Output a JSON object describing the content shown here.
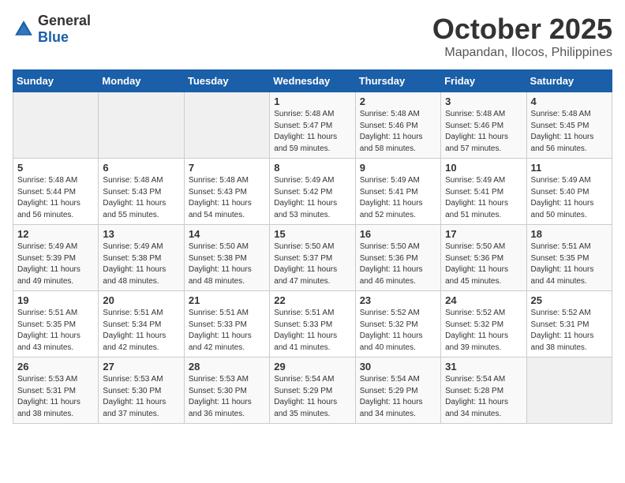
{
  "header": {
    "logo": {
      "general": "General",
      "blue": "Blue"
    },
    "title": "October 2025",
    "location": "Mapandan, Ilocos, Philippines"
  },
  "weekdays": [
    "Sunday",
    "Monday",
    "Tuesday",
    "Wednesday",
    "Thursday",
    "Friday",
    "Saturday"
  ],
  "weeks": [
    [
      {
        "day": "",
        "sunrise": "",
        "sunset": "",
        "daylight": ""
      },
      {
        "day": "",
        "sunrise": "",
        "sunset": "",
        "daylight": ""
      },
      {
        "day": "",
        "sunrise": "",
        "sunset": "",
        "daylight": ""
      },
      {
        "day": "1",
        "sunrise": "Sunrise: 5:48 AM",
        "sunset": "Sunset: 5:47 PM",
        "daylight": "Daylight: 11 hours and 59 minutes."
      },
      {
        "day": "2",
        "sunrise": "Sunrise: 5:48 AM",
        "sunset": "Sunset: 5:46 PM",
        "daylight": "Daylight: 11 hours and 58 minutes."
      },
      {
        "day": "3",
        "sunrise": "Sunrise: 5:48 AM",
        "sunset": "Sunset: 5:46 PM",
        "daylight": "Daylight: 11 hours and 57 minutes."
      },
      {
        "day": "4",
        "sunrise": "Sunrise: 5:48 AM",
        "sunset": "Sunset: 5:45 PM",
        "daylight": "Daylight: 11 hours and 56 minutes."
      }
    ],
    [
      {
        "day": "5",
        "sunrise": "Sunrise: 5:48 AM",
        "sunset": "Sunset: 5:44 PM",
        "daylight": "Daylight: 11 hours and 56 minutes."
      },
      {
        "day": "6",
        "sunrise": "Sunrise: 5:48 AM",
        "sunset": "Sunset: 5:43 PM",
        "daylight": "Daylight: 11 hours and 55 minutes."
      },
      {
        "day": "7",
        "sunrise": "Sunrise: 5:48 AM",
        "sunset": "Sunset: 5:43 PM",
        "daylight": "Daylight: 11 hours and 54 minutes."
      },
      {
        "day": "8",
        "sunrise": "Sunrise: 5:49 AM",
        "sunset": "Sunset: 5:42 PM",
        "daylight": "Daylight: 11 hours and 53 minutes."
      },
      {
        "day": "9",
        "sunrise": "Sunrise: 5:49 AM",
        "sunset": "Sunset: 5:41 PM",
        "daylight": "Daylight: 11 hours and 52 minutes."
      },
      {
        "day": "10",
        "sunrise": "Sunrise: 5:49 AM",
        "sunset": "Sunset: 5:41 PM",
        "daylight": "Daylight: 11 hours and 51 minutes."
      },
      {
        "day": "11",
        "sunrise": "Sunrise: 5:49 AM",
        "sunset": "Sunset: 5:40 PM",
        "daylight": "Daylight: 11 hours and 50 minutes."
      }
    ],
    [
      {
        "day": "12",
        "sunrise": "Sunrise: 5:49 AM",
        "sunset": "Sunset: 5:39 PM",
        "daylight": "Daylight: 11 hours and 49 minutes."
      },
      {
        "day": "13",
        "sunrise": "Sunrise: 5:49 AM",
        "sunset": "Sunset: 5:38 PM",
        "daylight": "Daylight: 11 hours and 48 minutes."
      },
      {
        "day": "14",
        "sunrise": "Sunrise: 5:50 AM",
        "sunset": "Sunset: 5:38 PM",
        "daylight": "Daylight: 11 hours and 48 minutes."
      },
      {
        "day": "15",
        "sunrise": "Sunrise: 5:50 AM",
        "sunset": "Sunset: 5:37 PM",
        "daylight": "Daylight: 11 hours and 47 minutes."
      },
      {
        "day": "16",
        "sunrise": "Sunrise: 5:50 AM",
        "sunset": "Sunset: 5:36 PM",
        "daylight": "Daylight: 11 hours and 46 minutes."
      },
      {
        "day": "17",
        "sunrise": "Sunrise: 5:50 AM",
        "sunset": "Sunset: 5:36 PM",
        "daylight": "Daylight: 11 hours and 45 minutes."
      },
      {
        "day": "18",
        "sunrise": "Sunrise: 5:51 AM",
        "sunset": "Sunset: 5:35 PM",
        "daylight": "Daylight: 11 hours and 44 minutes."
      }
    ],
    [
      {
        "day": "19",
        "sunrise": "Sunrise: 5:51 AM",
        "sunset": "Sunset: 5:35 PM",
        "daylight": "Daylight: 11 hours and 43 minutes."
      },
      {
        "day": "20",
        "sunrise": "Sunrise: 5:51 AM",
        "sunset": "Sunset: 5:34 PM",
        "daylight": "Daylight: 11 hours and 42 minutes."
      },
      {
        "day": "21",
        "sunrise": "Sunrise: 5:51 AM",
        "sunset": "Sunset: 5:33 PM",
        "daylight": "Daylight: 11 hours and 42 minutes."
      },
      {
        "day": "22",
        "sunrise": "Sunrise: 5:51 AM",
        "sunset": "Sunset: 5:33 PM",
        "daylight": "Daylight: 11 hours and 41 minutes."
      },
      {
        "day": "23",
        "sunrise": "Sunrise: 5:52 AM",
        "sunset": "Sunset: 5:32 PM",
        "daylight": "Daylight: 11 hours and 40 minutes."
      },
      {
        "day": "24",
        "sunrise": "Sunrise: 5:52 AM",
        "sunset": "Sunset: 5:32 PM",
        "daylight": "Daylight: 11 hours and 39 minutes."
      },
      {
        "day": "25",
        "sunrise": "Sunrise: 5:52 AM",
        "sunset": "Sunset: 5:31 PM",
        "daylight": "Daylight: 11 hours and 38 minutes."
      }
    ],
    [
      {
        "day": "26",
        "sunrise": "Sunrise: 5:53 AM",
        "sunset": "Sunset: 5:31 PM",
        "daylight": "Daylight: 11 hours and 38 minutes."
      },
      {
        "day": "27",
        "sunrise": "Sunrise: 5:53 AM",
        "sunset": "Sunset: 5:30 PM",
        "daylight": "Daylight: 11 hours and 37 minutes."
      },
      {
        "day": "28",
        "sunrise": "Sunrise: 5:53 AM",
        "sunset": "Sunset: 5:30 PM",
        "daylight": "Daylight: 11 hours and 36 minutes."
      },
      {
        "day": "29",
        "sunrise": "Sunrise: 5:54 AM",
        "sunset": "Sunset: 5:29 PM",
        "daylight": "Daylight: 11 hours and 35 minutes."
      },
      {
        "day": "30",
        "sunrise": "Sunrise: 5:54 AM",
        "sunset": "Sunset: 5:29 PM",
        "daylight": "Daylight: 11 hours and 34 minutes."
      },
      {
        "day": "31",
        "sunrise": "Sunrise: 5:54 AM",
        "sunset": "Sunset: 5:28 PM",
        "daylight": "Daylight: 11 hours and 34 minutes."
      },
      {
        "day": "",
        "sunrise": "",
        "sunset": "",
        "daylight": ""
      }
    ]
  ]
}
